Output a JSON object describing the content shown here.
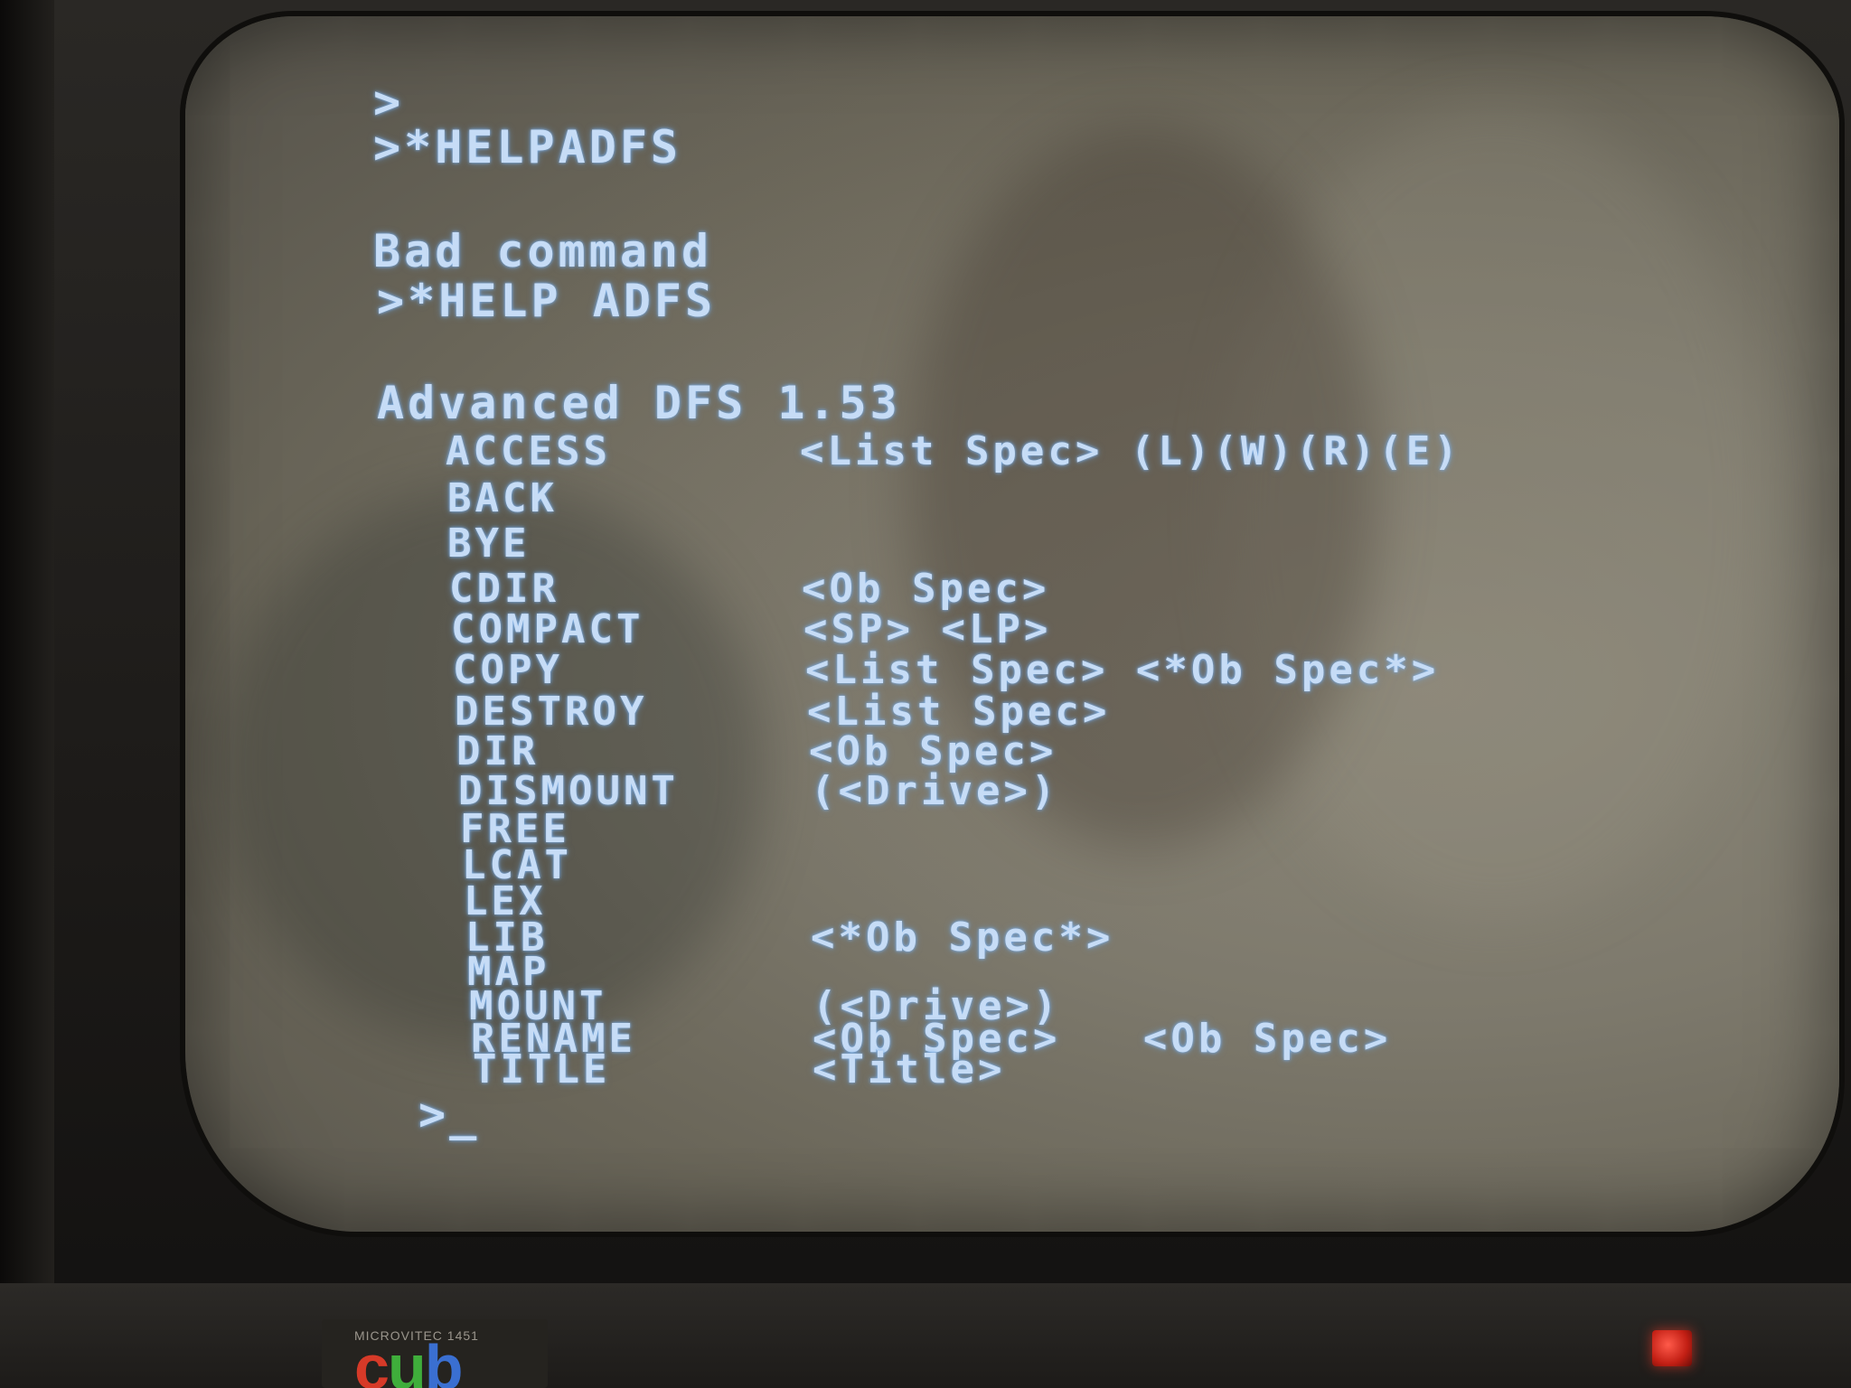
{
  "terminal": {
    "lines": {
      "prompt1": ">",
      "cmd1": ">*HELPADFS",
      "error": "Bad command",
      "cmd2": ">*HELP ADFS",
      "header": "Advanced DFS 1.53",
      "final_prompt": ">_"
    },
    "commands": [
      {
        "name": "ACCESS",
        "args": "<List Spec> (L)(W)(R)(E)"
      },
      {
        "name": "BACK",
        "args": ""
      },
      {
        "name": "BYE",
        "args": ""
      },
      {
        "name": "CDIR",
        "args": "<Ob Spec>"
      },
      {
        "name": "COMPACT",
        "args": "<SP> <LP>"
      },
      {
        "name": "COPY",
        "args": "<List Spec> <*Ob Spec*>"
      },
      {
        "name": "DESTROY",
        "args": "<List Spec>"
      },
      {
        "name": "DIR",
        "args": "<Ob Spec>"
      },
      {
        "name": "DISMOUNT",
        "args": "(<Drive>)"
      },
      {
        "name": "FREE",
        "args": ""
      },
      {
        "name": "LCAT",
        "args": ""
      },
      {
        "name": "LEX",
        "args": ""
      },
      {
        "name": "LIB",
        "args": "<*Ob Spec*>"
      },
      {
        "name": "MAP",
        "args": ""
      },
      {
        "name": "MOUNT",
        "args": "(<Drive>)"
      },
      {
        "name": "RENAME",
        "args": "<Ob Spec>   <Ob Spec>"
      },
      {
        "name": "TITLE",
        "args": "<Title>"
      }
    ],
    "text_color": "#c6dcf6",
    "glow_color": "#7fb4f0"
  },
  "monitor": {
    "brand_small": "MICROVITEC 1451",
    "brand_logo": {
      "c": "c",
      "u": "u",
      "b": "b"
    },
    "power_led_color": "#e0321f"
  }
}
